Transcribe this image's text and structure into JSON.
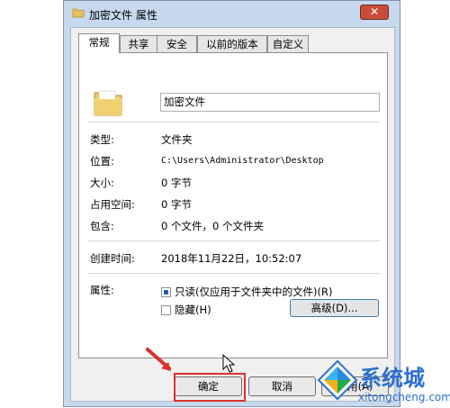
{
  "window": {
    "title": "加密文件 属性",
    "close_label": "✕"
  },
  "tabs": [
    "常规",
    "共享",
    "安全",
    "以前的版本",
    "自定义"
  ],
  "general": {
    "name_value": "加密文件",
    "type_label": "类型:",
    "type_value": "文件夹",
    "location_label": "位置:",
    "location_value": "C:\\Users\\Administrator\\Desktop",
    "size_label": "大小:",
    "size_value": "0 字节",
    "disk_size_label": "占用空间:",
    "disk_size_value": "0 字节",
    "contains_label": "包含:",
    "contains_value": "0 个文件，0 个文件夹",
    "created_label": "创建时间:",
    "created_value": "2018年11月22日，10:52:07",
    "attributes_label": "属性:",
    "readonly_label": "只读(仅应用于文件夹中的文件)(R)",
    "readonly_checked": true,
    "hidden_label": "隐藏(H)",
    "hidden_checked": false,
    "advanced_label": "高级(D)..."
  },
  "buttons": {
    "ok": "确定",
    "cancel": "取消",
    "apply": "应用(A)"
  },
  "watermark": {
    "name": "系统城",
    "url": "xitongcheng.com"
  },
  "colors": {
    "highlight": "#e0302f",
    "arrow": "#d9302a",
    "watermark": "#2c6fcf"
  }
}
